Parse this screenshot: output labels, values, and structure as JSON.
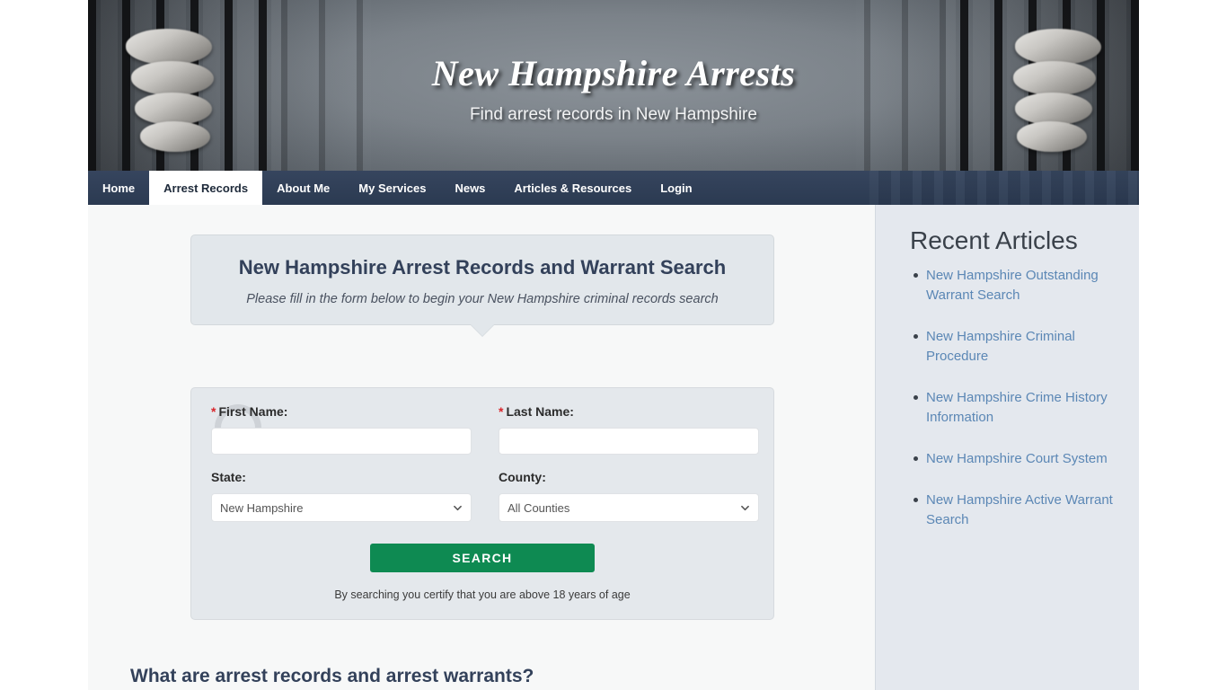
{
  "banner": {
    "title": "New Hampshire Arrests",
    "tagline": "Find arrest records in New Hampshire"
  },
  "nav": {
    "items": [
      {
        "label": "Home",
        "active": false
      },
      {
        "label": "Arrest Records",
        "active": true
      },
      {
        "label": "About Me",
        "active": false
      },
      {
        "label": "My Services",
        "active": false
      },
      {
        "label": "News",
        "active": false
      },
      {
        "label": "Articles & Resources",
        "active": false
      },
      {
        "label": "Login",
        "active": false
      }
    ]
  },
  "callout": {
    "heading": "New Hampshire Arrest Records and Warrant Search",
    "subheading": "Please fill in the form below to begin your New Hampshire criminal records search"
  },
  "form": {
    "first_name": {
      "label": "First Name:",
      "required_mark": "*",
      "value": "",
      "placeholder": ""
    },
    "last_name": {
      "label": "Last Name:",
      "required_mark": "*",
      "value": "",
      "placeholder": ""
    },
    "state": {
      "label": "State:",
      "selected": "New Hampshire",
      "options": [
        "New Hampshire"
      ]
    },
    "county": {
      "label": "County:",
      "selected": "All Counties",
      "options": [
        "All Counties"
      ]
    },
    "search_button": "SEARCH",
    "disclaimer": "By searching you certify that you are above 18 years of age"
  },
  "article_section": {
    "heading": "What are arrest records and arrest warrants?"
  },
  "sidebar": {
    "title": "Recent Articles",
    "links": [
      "New Hampshire Outstanding Warrant Search",
      "New Hampshire Criminal Procedure",
      "New Hampshire Crime History Information",
      "New Hampshire Court System",
      "New Hampshire Active Warrant Search"
    ]
  },
  "colors": {
    "nav_bar": "#2d3d55",
    "heading_blue": "#33415a",
    "search_green": "#0e8a52",
    "link_blue": "#5b87b5",
    "required_red": "#d9262c",
    "sidebar_bg": "#e4e8ee",
    "panel_bg": "#e4e8ec",
    "content_bg": "#f7f8f8"
  }
}
